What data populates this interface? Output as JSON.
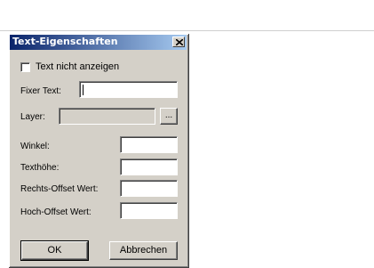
{
  "dialog": {
    "title": "Text-Eigenschaften",
    "close_label": "close",
    "hide_text_label": "Text nicht anzeigen",
    "hide_text_checked": false,
    "fixed_text_label": "Fixer Text:",
    "fixed_text_value": "",
    "layer_label": "Layer:",
    "layer_value": "",
    "layer_browse_label": "...",
    "angle_label": "Winkel:",
    "angle_value": "",
    "text_height_label": "Texthöhe:",
    "text_height_value": "",
    "right_offset_label": "Rechts-Offset Wert:",
    "right_offset_value": "",
    "up_offset_label": "Hoch-Offset Wert:",
    "up_offset_value": "",
    "ok_label": "OK",
    "cancel_label": "Abbrechen"
  },
  "colors": {
    "dialog_bg": "#d4d0c8",
    "titlebar_start": "#0a246a",
    "titlebar_end": "#a6caf0",
    "title_text": "#ffffff"
  },
  "icons": {
    "close": "close-icon"
  }
}
